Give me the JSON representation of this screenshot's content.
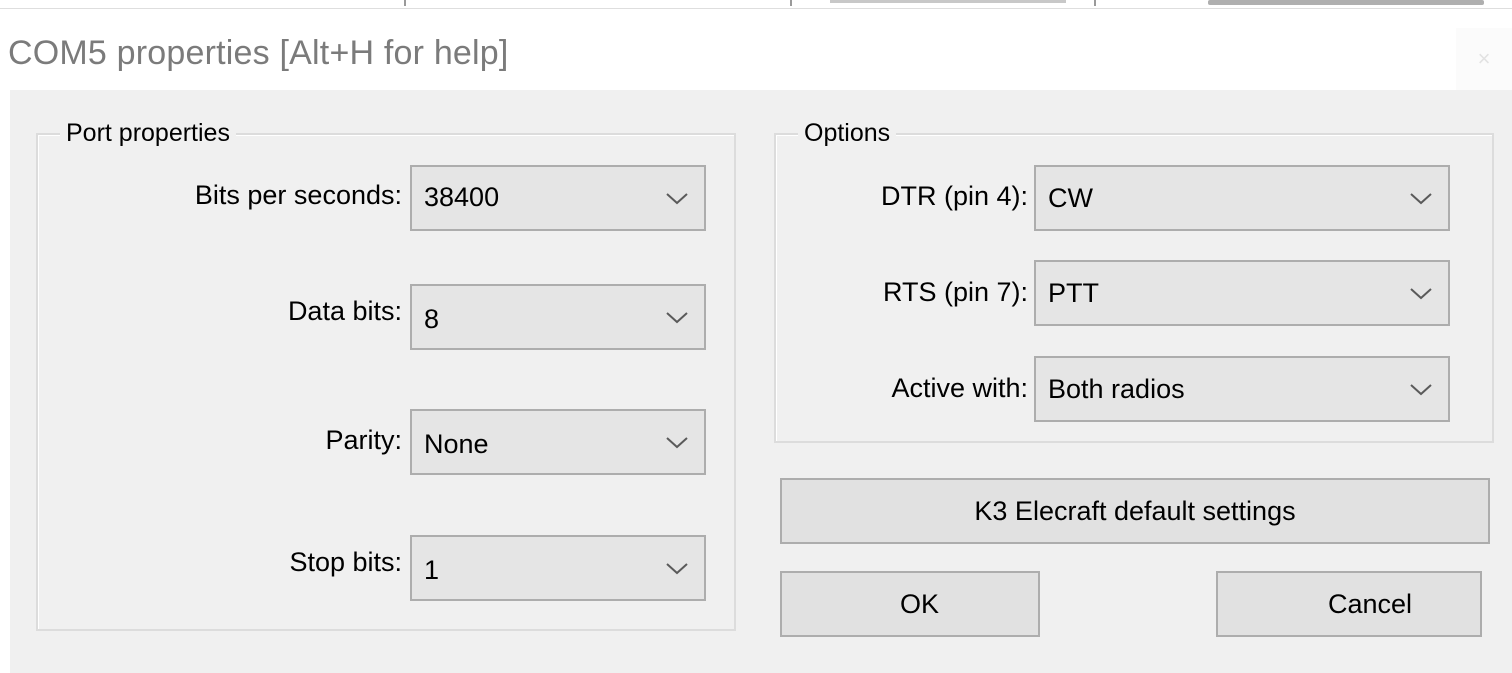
{
  "window": {
    "title": "COM5 properties [Alt+H for help]",
    "close_glyph": "×"
  },
  "port_properties": {
    "group_label": "Port properties",
    "bits_per_second": {
      "label": "Bits per seconds:",
      "value": "38400"
    },
    "data_bits": {
      "label": "Data bits:",
      "value": "8"
    },
    "parity": {
      "label": "Parity:",
      "value": "None"
    },
    "stop_bits": {
      "label": "Stop bits:",
      "value": "1"
    }
  },
  "options": {
    "group_label": "Options",
    "dtr": {
      "label": "DTR (pin 4):",
      "value": "CW"
    },
    "rts": {
      "label": "RTS (pin 7):",
      "value": "PTT"
    },
    "active_with": {
      "label": "Active with:",
      "value": "Both radios"
    }
  },
  "buttons": {
    "defaults_label": "K3 Elecraft default settings",
    "ok_label": "OK",
    "cancel_label": "Cancel"
  },
  "icons": {
    "dropdown": "chevron-down-icon",
    "close": "close-icon"
  }
}
